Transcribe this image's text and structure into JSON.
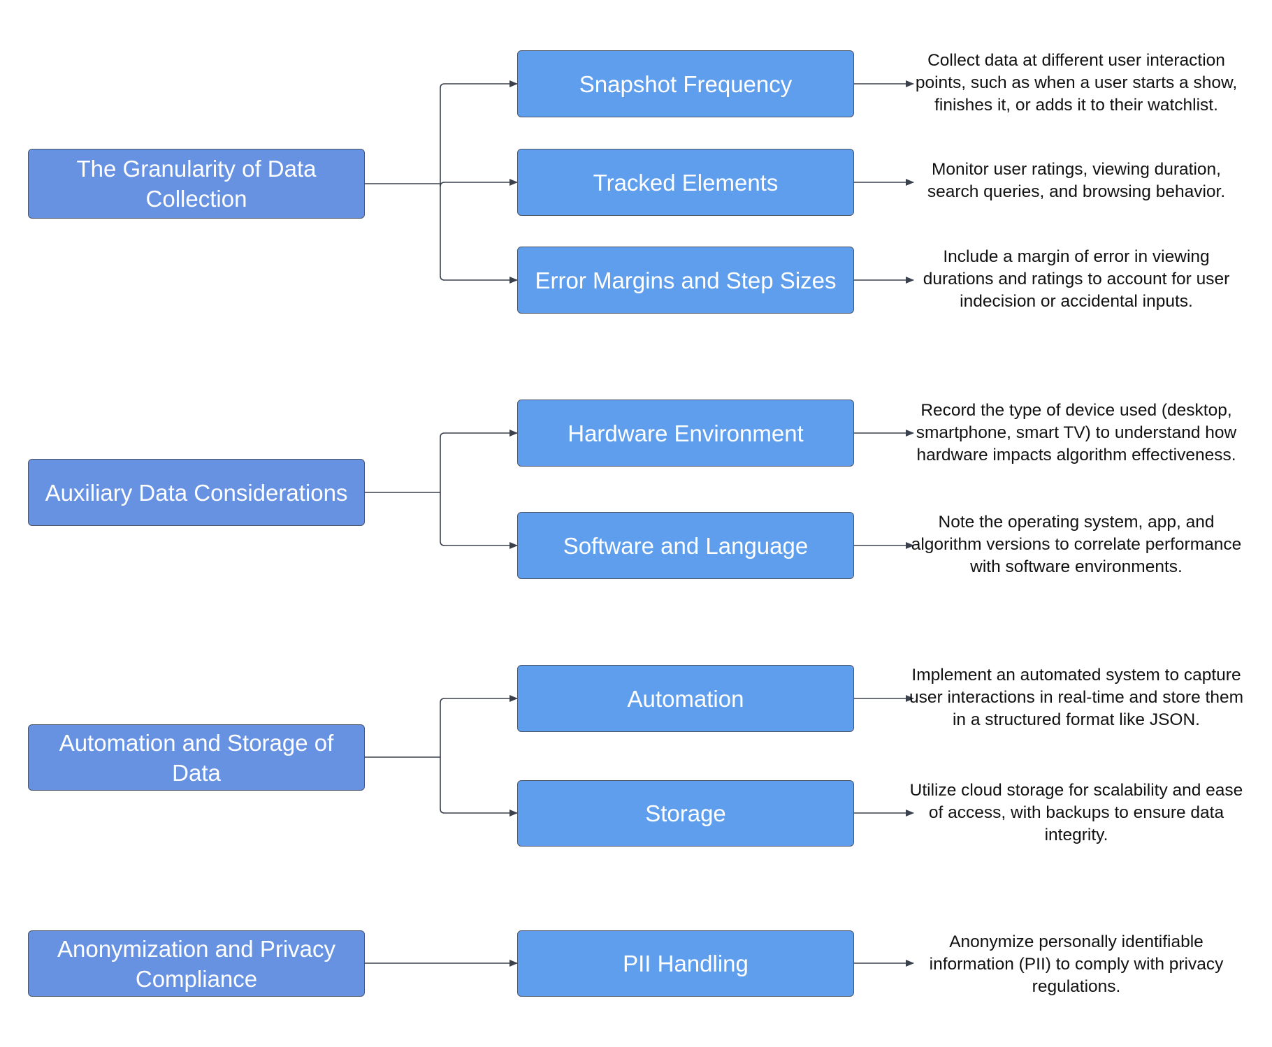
{
  "diagram": {
    "colors": {
      "topic_fill": "#6792e2",
      "subtopic_fill": "#5f9eed",
      "border": "#4a5568",
      "connector": "#3a414d",
      "node_text": "#ffffff",
      "description_text": "#111111"
    },
    "groups": [
      {
        "topic": "The Granularity of Data Collection",
        "items": [
          {
            "label": "Snapshot Frequency",
            "description": "Collect data at different user interaction points, such as when a user starts a show, finishes it, or adds it to their watchlist."
          },
          {
            "label": "Tracked Elements",
            "description": "Monitor user ratings, viewing duration, search queries, and browsing behavior."
          },
          {
            "label": "Error Margins and Step Sizes",
            "description": "Include a margin of error in viewing durations and ratings to account for user indecision or accidental inputs."
          }
        ]
      },
      {
        "topic": "Auxiliary Data Considerations",
        "items": [
          {
            "label": "Hardware Environment",
            "description": "Record the type of device used (desktop, smartphone, smart TV) to understand how hardware impacts algorithm effectiveness."
          },
          {
            "label": "Software and Language",
            "description": "Note the operating system, app, and algorithm versions to correlate performance with software environments."
          }
        ]
      },
      {
        "topic": "Automation and Storage of Data",
        "items": [
          {
            "label": "Automation",
            "description": "Implement an automated system to capture user interactions in real-time and store them in a structured format like JSON."
          },
          {
            "label": "Storage",
            "description": "Utilize cloud storage for scalability and ease of access, with backups to ensure data integrity."
          }
        ]
      },
      {
        "topic": "Anonymization and Privacy Compliance",
        "items": [
          {
            "label": "PII Handling",
            "description": "Anonymize personally identifiable information (PII) to comply with privacy regulations."
          }
        ]
      }
    ]
  }
}
